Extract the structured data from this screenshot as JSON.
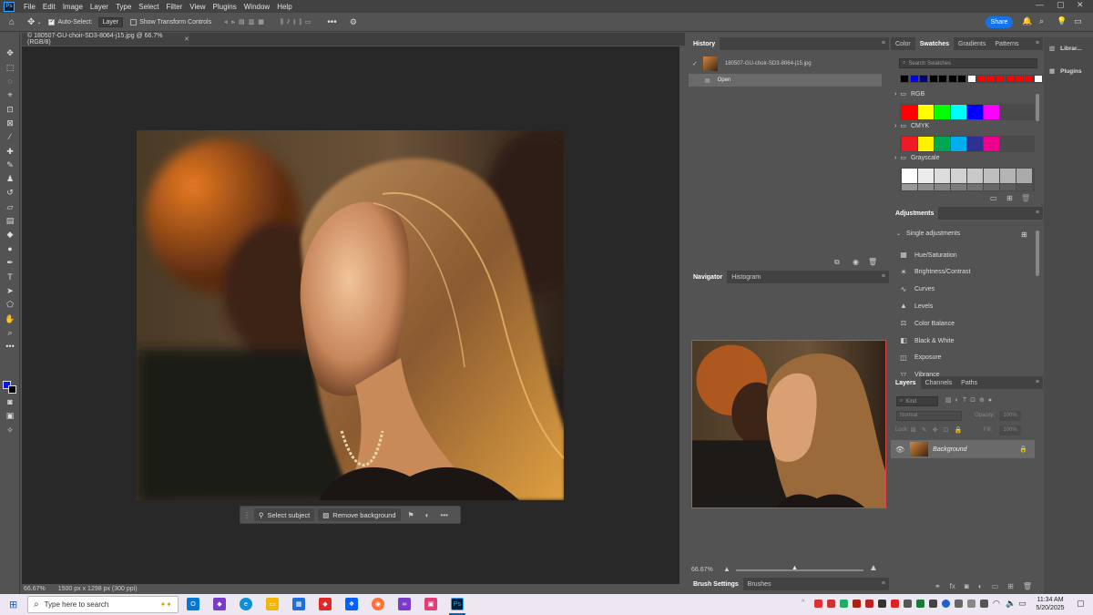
{
  "menubar": {
    "logo": "Ps",
    "items": [
      "File",
      "Edit",
      "Image",
      "Layer",
      "Type",
      "Select",
      "Filter",
      "View",
      "Plugins",
      "Window",
      "Help"
    ]
  },
  "options": {
    "auto_select_label": "Auto-Select:",
    "auto_select_value": "Layer",
    "show_transform_label": "Show Transform Controls",
    "share_label": "Share"
  },
  "document": {
    "tab_title": "© 180507-GU-choir-SD3-8064-j15.jpg @ 66.7% (RGB/8)",
    "zoom": "66.67%",
    "info": "1500 px x 1298 px (300 ppi)"
  },
  "contextbar": {
    "select_subject": "Select subject",
    "remove_background": "Remove background"
  },
  "history": {
    "tab": "History",
    "snapshot": "180507-GU-choir-SD3-8064-j15.jpg",
    "step": "Open"
  },
  "navigator": {
    "tabs": [
      "Navigator",
      "Histogram"
    ],
    "zoom": "66.67%"
  },
  "brush": {
    "tabs": [
      "Brush Settings",
      "Brushes"
    ]
  },
  "swatches": {
    "tabs": [
      "Color",
      "Swatches",
      "Gradients",
      "Patterns"
    ],
    "search_placeholder": "Search Swatches",
    "top_row": [
      "#000000",
      "#0000ff",
      "#000080",
      "#000000",
      "#000000",
      "#000000",
      "#000000",
      "#ffffff",
      "#ff0000",
      "#ff0000",
      "#ff0000",
      "#ff0000",
      "#ff0000",
      "#ff0000",
      "#ffffff"
    ],
    "groups": [
      {
        "name": "RGB",
        "colors": [
          "#ff0000",
          "#ffff00",
          "#00ff00",
          "#00ffff",
          "#0000ff",
          "#ff00ff"
        ]
      },
      {
        "name": "CMYK",
        "colors": [
          "#ed1c24",
          "#fff200",
          "#00a651",
          "#00aeef",
          "#2e3192",
          "#ec008c"
        ]
      },
      {
        "name": "Grayscale",
        "colors": [
          "#ffffff",
          "#ebebeb",
          "#dcdcdc",
          "#d2d2d2",
          "#c8c8c8",
          "#bebebe",
          "#b4b4b4",
          "#aaaaaa"
        ]
      }
    ]
  },
  "adjustments": {
    "tab": "Adjustments",
    "section": "Single adjustments",
    "items": [
      {
        "label": "Hue/Saturation",
        "icon": "hue-saturation-icon"
      },
      {
        "label": "Brightness/Contrast",
        "icon": "brightness-icon"
      },
      {
        "label": "Curves",
        "icon": "curves-icon"
      },
      {
        "label": "Levels",
        "icon": "levels-icon"
      },
      {
        "label": "Color Balance",
        "icon": "color-balance-icon"
      },
      {
        "label": "Black & White",
        "icon": "black-white-icon"
      },
      {
        "label": "Exposure",
        "icon": "exposure-icon"
      },
      {
        "label": "Vibrance",
        "icon": "vibrance-icon"
      }
    ]
  },
  "layers": {
    "tabs": [
      "Layers",
      "Channels",
      "Paths"
    ],
    "kind_placeholder": "Kind",
    "blend_mode": "Normal",
    "opacity_label": "Opacity:",
    "opacity_value": "100%",
    "lock_label": "Lock:",
    "fill_label": "Fill:",
    "fill_value": "100%",
    "layer_name": "Background"
  },
  "rightdock": {
    "items": [
      "Librar...",
      "Plugins"
    ]
  },
  "taskbar": {
    "search_placeholder": "Type here to search",
    "time": "11:34 AM",
    "date": "5/20/2025"
  }
}
